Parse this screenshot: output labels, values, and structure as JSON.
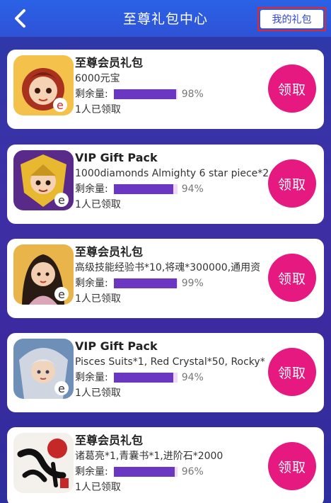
{
  "header": {
    "title": "至尊礼包中心",
    "my_gift_label": "我的礼包"
  },
  "colors": {
    "header": "#2f55d8",
    "background": "#3a2fa2",
    "claim_button": "#e5197f",
    "progress_fill": "#6a36c2",
    "progress_track": "#f1d8f4",
    "highlight_border": "#e02a2a"
  },
  "gifts": [
    {
      "name": "至尊会员礼包",
      "desc": "6000元宝",
      "remain_label": "剩余量:",
      "percent": 98,
      "percent_text": "98%",
      "claimed_text": "1人已领取",
      "claim_label": "领取",
      "icon": "game-icon-red-hair-girl"
    },
    {
      "name": "VIP Gift Pack",
      "desc": "1000diamonds Almighty 6 star piece*2",
      "remain_label": "剩余量:",
      "percent": 94,
      "percent_text": "94%",
      "claimed_text": "1人已领取",
      "claim_label": "领取",
      "icon": "game-icon-golden-warrior"
    },
    {
      "name": "至尊会员礼包",
      "desc": "高级技能经验书*10,将魂*300000,通用资",
      "remain_label": "剩余量:",
      "percent": 99,
      "percent_text": "99%",
      "claimed_text": "1人已领取",
      "claim_label": "领取",
      "icon": "game-icon-maiden"
    },
    {
      "name": "VIP Gift Pack",
      "desc": "Pisces Suits*1, Red Crystal*50, Rocky*",
      "remain_label": "剩余量:",
      "percent": 94,
      "percent_text": "94%",
      "claimed_text": "1人已领取",
      "claim_label": "领取",
      "icon": "game-icon-silver-knight"
    },
    {
      "name": "至尊会员礼包",
      "desc": "诸葛亮*1,青囊书*1,进阶石*2000",
      "remain_label": "剩余量:",
      "percent": 96,
      "percent_text": "96%",
      "claimed_text": "1人已领取",
      "claim_label": "领取",
      "icon": "game-icon-calligraphy"
    }
  ]
}
